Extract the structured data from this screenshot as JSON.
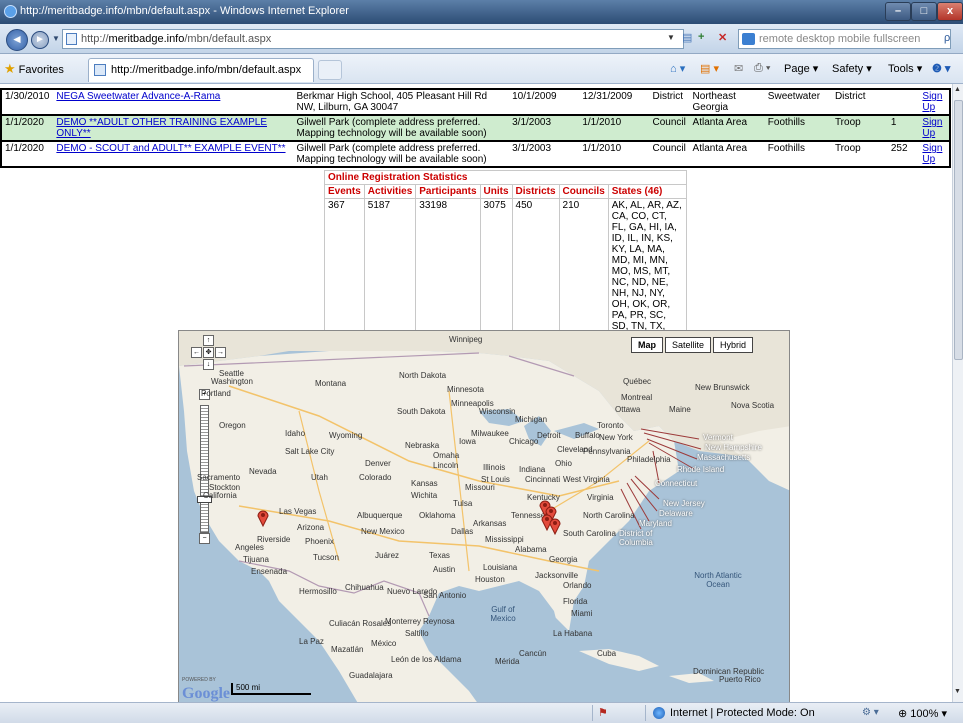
{
  "window": {
    "title": "http://meritbadge.info/mbn/default.aspx - Windows Internet Explorer",
    "minimize": "–",
    "maximize": "□",
    "close": "x"
  },
  "address": {
    "url_prefix": "http://",
    "url_host": "meritbadge.info",
    "url_path": "/mbn/default.aspx",
    "search_placeholder": "remote desktop mobile fullscreen",
    "back": "◄",
    "forward": "►",
    "dropdown": "▼",
    "refresh": "+",
    "stop": "✕",
    "search": "ρ"
  },
  "favorites_bar": {
    "favorites_label": "Favorites",
    "tab_title": "http://meritbadge.info/mbn/default.aspx",
    "home": "⌂ ▾",
    "feeds": "▤ ▾",
    "mail": "✉",
    "print": "⎙ ▾",
    "page": "Page ▾",
    "safety": "Safety ▾",
    "tools": "Tools ▾",
    "help": "❷ ▾"
  },
  "events": [
    {
      "date": "1/30/2010",
      "name": "NEGA Sweetwater Advance-A-Rama",
      "location": "Berkmar High School, 405 Pleasant Hill Rd NW, Lilburn, GA 30047",
      "start": "10/1/2009",
      "end": "12/31/2009",
      "level": "District",
      "council": "Northeast Georgia",
      "district": "Sweetwater",
      "type": "District",
      "unit": "",
      "signup": "Sign Up",
      "row_style": "white"
    },
    {
      "date": "1/1/2020",
      "name": "DEMO **ADULT OTHER TRAINING EXAMPLE ONLY**",
      "location": "Gilwell Park (complete address preferred. Mapping technology will be available soon)",
      "start": "3/1/2003",
      "end": "1/1/2010",
      "level": "Council",
      "council": "Atlanta Area",
      "district": "Foothills",
      "type": "Troop",
      "unit": "1",
      "signup": "Sign Up",
      "row_style": "green"
    },
    {
      "date": "1/1/2020",
      "name": "DEMO - SCOUT and ADULT** EXAMPLE EVENT**",
      "location": "Gilwell Park (complete address preferred. Mapping technology will be available soon)",
      "start": "3/1/2003",
      "end": "1/1/2010",
      "level": "Council",
      "council": "Atlanta Area",
      "district": "Foothills",
      "type": "Troop",
      "unit": "252",
      "signup": "Sign Up",
      "row_style": "white"
    }
  ],
  "stats": {
    "caption": "Online Registration Statistics",
    "headers": [
      "Events",
      "Activities",
      "Participants",
      "Units",
      "Districts",
      "Councils",
      "States (46)"
    ],
    "values": [
      "367",
      "5187",
      "33198",
      "3075",
      "450",
      "210",
      "AK, AL, AR, AZ, CA, CO, CT, FL, GA, HI, IA, ID, IL, IN, KS, KY, LA, MA, MD, MI, MN, MO, MS, MT, NC, ND, NE, NH, NJ, NY, OH, OK, OR, PA, PR, SC, SD, TN, TX, UT, VA, WA, WI, WV, WY"
    ]
  },
  "map": {
    "types": [
      "Map",
      "Satellite",
      "Hybrid"
    ],
    "selected_type": "Map",
    "scale": "500 mi",
    "logo": "Google",
    "powered_by": "POWERED BY",
    "pan_up": "↑",
    "pan_left": "←",
    "pan_right": "→",
    "pan_down": "↓",
    "pan_center": "✥",
    "zoom_in": "+",
    "zoom_out": "−",
    "labels": {
      "washington": "Washington",
      "oregon": "Oregon",
      "california": "California",
      "nevada": "Nevada",
      "idaho": "Idaho",
      "montana": "Montana",
      "wyoming": "Wyoming",
      "utah": "Utah",
      "arizona": "Arizona",
      "colorado": "Colorado",
      "new_mexico": "New Mexico",
      "north_dakota": "North Dakota",
      "south_dakota": "South Dakota",
      "nebraska": "Nebraska",
      "kansas": "Kansas",
      "oklahoma": "Oklahoma",
      "texas": "Texas",
      "minnesota": "Minnesota",
      "iowa": "Iowa",
      "missouri": "Missouri",
      "arkansas": "Arkansas",
      "louisiana": "Louisiana",
      "wisconsin": "Wisconsin",
      "illinois": "Illinois",
      "michigan": "Michigan",
      "indiana": "Indiana",
      "ohio": "Ohio",
      "kentucky": "Kentucky",
      "tennessee": "Tennessee",
      "mississippi": "Mississippi",
      "alabama": "Alabama",
      "georgia": "Georgia",
      "florida": "Florida",
      "south_carolina": "South Carolina",
      "north_carolina": "North Carolina",
      "virginia": "Virginia",
      "west_virginia": "West Virginia",
      "pennsylvania": "Pennsylvania",
      "new_york": "New York",
      "maine": "Maine",
      "mexico": "México",
      "cuba": "Cuba",
      "chihuahua": "Chihuahua",
      "monterrey": "Monterrey",
      "gulf_of_mexico": "Gulf of Mexico",
      "north_atlantic": "North Atlantic Ocean",
      "quebec": "Québec",
      "new_brunswick": "New Brunswick",
      "nova_scotia": "Nova Scotia",
      "winnipeg": "Winnipeg",
      "denver": "Denver",
      "dallas": "Dallas",
      "houston": "Houston",
      "atlanta_chicago": "Chicago",
      "toronto": "Toronto",
      "montreal": "Montreal",
      "ottawa": "Ottawa",
      "la_habana": "La Habana",
      "dominican": "Dominican Republic",
      "puerto_rico": "Puerto Rico",
      "los_angeles": "Angeles",
      "las_vegas": "Las Vegas",
      "phoenix": "Phoenix",
      "tucson": "Tucson",
      "memphis": "Memphis",
      "st_louis": "St Louis",
      "cincinnati": "Cincinnati",
      "detroit": "Detroit",
      "cleveland": "Cleveland",
      "buffalo": "Buffalo",
      "philadelphia": "Philadelphia",
      "jacksonville": "Jacksonville",
      "orlando": "Orlando",
      "miami": "Miami",
      "wichita": "Wichita",
      "tulsa": "Tulsa",
      "omaha": "Omaha",
      "lincoln": "Lincoln",
      "milwaukee": "Milwaukee",
      "minneapolis": "Minneapolis",
      "salt_lake": "Salt Lake City",
      "portland": "Portland",
      "sacramento": "Sacramento",
      "stockton": "Stockton",
      "riverside": "Riverside",
      "tijuana": "Tijuana",
      "ensenada": "Ensenada",
      "hermosillo": "Hermosillo",
      "albuquerque": "Albuquerque",
      "juarez": "Juárez",
      "austin": "Austin",
      "san_antonio": "San Antonio",
      "nuevo_laredo": "Nuevo Laredo",
      "reynosa": "Reynosa",
      "saltillo": "Saltillo",
      "mazatlan": "Mazatlán",
      "la_paz": "La Paz",
      "culiacan": "Culiacán Rosales",
      "guadalajara": "Guadalajara",
      "leon": "León de los Aldama",
      "merida": "Mérida",
      "cancun": "Cancún",
      "seattle": "Seattle"
    },
    "callouts": [
      "Vermont",
      "New Hampshire",
      "Massachusetts",
      "Rhode Island",
      "Connecticut",
      "New Jersey",
      "Delaware",
      "Maryland",
      "District of Columbia"
    ]
  },
  "status": {
    "zone": "Internet | Protected Mode: On",
    "zoom": "100%",
    "zoom_drop": "▾"
  }
}
